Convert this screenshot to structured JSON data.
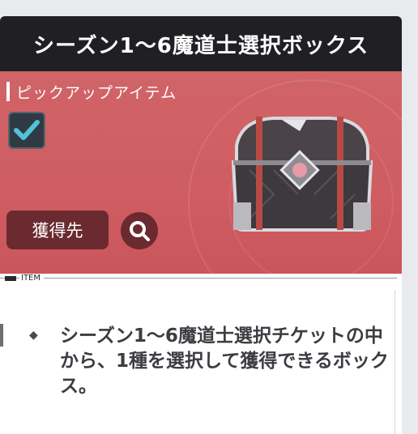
{
  "title": "シーズン1〜6魔道士選択ボックス",
  "pickup_label": "ピックアップアイテム",
  "checkbox_checked": true,
  "acquire_button_label": "獲得先",
  "search_icon": "search-icon",
  "section_tab_label": "ITEM",
  "description": "シーズン1〜6魔道士選択チケットの中から、1種を選択して獲得できるボックス。",
  "bullet": "◆",
  "colors": {
    "title_bg": "#1f1f24",
    "banner_bg": "#cf5d62",
    "button_bg": "#6a2a30",
    "check_accent": "#4fc3d9"
  }
}
